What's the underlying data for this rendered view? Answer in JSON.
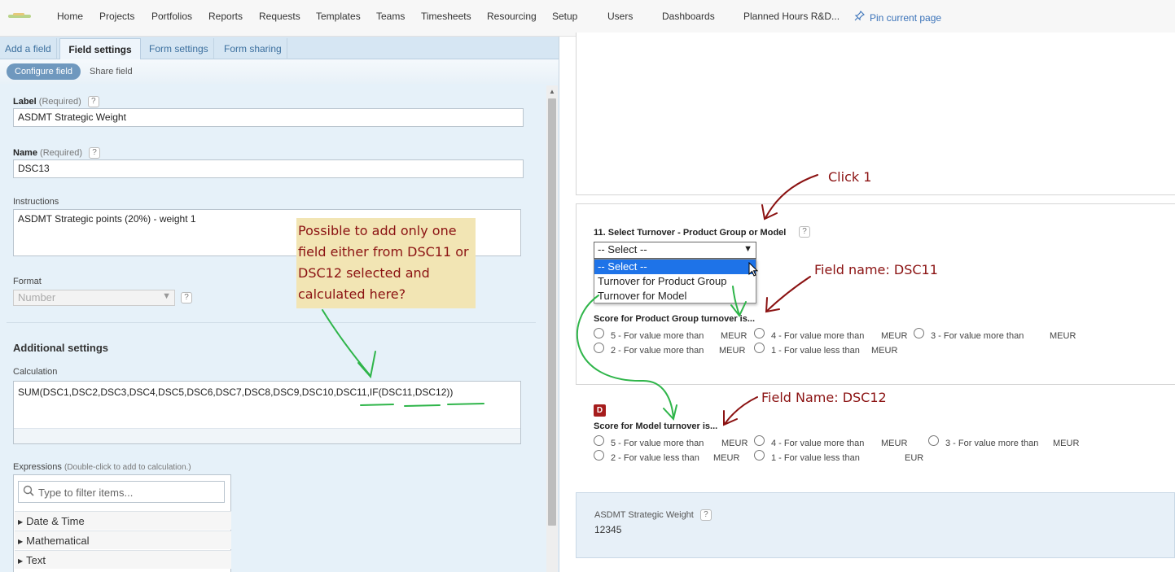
{
  "nav": {
    "items": [
      "Home",
      "Projects",
      "Portfolios",
      "Reports",
      "Requests",
      "Templates",
      "Teams",
      "Timesheets",
      "Resourcing",
      "Setup",
      "Users",
      "Dashboards",
      "Planned Hours R&D..."
    ],
    "pin_label": "Pin current page"
  },
  "left": {
    "tabs": [
      "Add a field",
      "Field settings",
      "Form settings",
      "Form sharing"
    ],
    "active_tab": "Field settings",
    "subtabs": {
      "configure": "Configure field",
      "share": "Share field"
    },
    "label_field": {
      "label": "Label",
      "req": "(Required)",
      "value": "ASDMT Strategic Weight"
    },
    "name_field": {
      "label": "Name",
      "req": "(Required)",
      "value": "DSC13"
    },
    "instructions": {
      "label": "Instructions",
      "value": "ASDMT Strategic points (20%) - weight 1"
    },
    "format": {
      "label": "Format",
      "value": "Number"
    },
    "additional_settings": "Additional settings",
    "calculation": {
      "label": "Calculation",
      "value": "SUM(DSC1,DSC2,DSC3,DSC4,DSC5,DSC6,DSC7,DSC8,DSC9,DSC10,DSC11,IF(DSC11,DSC12))"
    },
    "expressions": {
      "label": "Expressions",
      "hint": "(Double-click to add to calculation.)",
      "search_placeholder": "Type to filter items...",
      "items": [
        "Date & Time",
        "Mathematical",
        "Text"
      ]
    },
    "help_glyph": "?"
  },
  "right": {
    "q11": {
      "label": "11. Select Turnover - Product Group or Model",
      "selected": "-- Select --",
      "options": [
        "-- Select --",
        "Turnover for Product Group",
        "Turnover for Model"
      ]
    },
    "pg": {
      "label": "Score for Product Group turnover is...",
      "options": [
        "5 - For value more than",
        "4 - For value more than",
        "3 - For value more than",
        "2 - For value more than",
        "1 - For value less than"
      ],
      "unit": "MEUR"
    },
    "model": {
      "badge": "D",
      "label": "Score for Model turnover is...",
      "options": [
        "5 - For value more than",
        "4 - For value more than",
        "3 - For value more than",
        "2 - For value less than",
        "1 - For value less than"
      ],
      "unit": "MEUR",
      "last_unit": "EUR"
    },
    "weight": {
      "label": "ASDMT Strategic Weight",
      "value": "12345"
    }
  },
  "annotations": {
    "note": "Possible to add only one field either from DSC11 or DSC12 selected and calculated here?",
    "click1": "Click 1",
    "field_dsc11": "Field name: DSC11",
    "field_dsc12": "Field Name: DSC12"
  },
  "colors": {
    "accent": "#3b73b9",
    "annotation": "#8b1212",
    "note_bg": "#f2e5b4",
    "arrow_green": "#2fb54a",
    "select_highlight": "#1e73e8"
  }
}
